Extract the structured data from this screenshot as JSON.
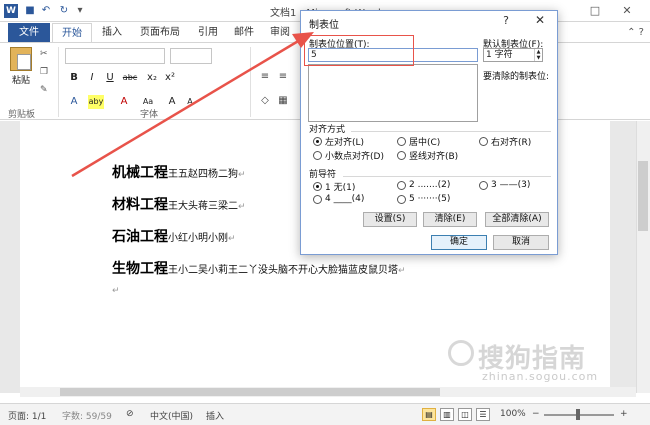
{
  "window": {
    "title": "文档1 - Microsoft Word",
    "app_logo": "W"
  },
  "ribbon_tabs": [
    {
      "label": "文件"
    },
    {
      "label": "开始"
    },
    {
      "label": "插入"
    },
    {
      "label": "页面布局"
    },
    {
      "label": "引用"
    },
    {
      "label": "邮件"
    },
    {
      "label": "审阅"
    }
  ],
  "ribbon": {
    "paste_label": "粘贴",
    "clipboard_group": "剪贴板",
    "font_group": "字体",
    "font_buttons": [
      "B",
      "I",
      "U",
      "abc",
      "x₂",
      "x²"
    ],
    "font_buttons2": [
      "A",
      "aby",
      "A",
      "Aa",
      "A",
      "A"
    ]
  },
  "document": {
    "lines": [
      {
        "head": "机械工程",
        "body": "王五赵四杨二狗"
      },
      {
        "head": "材料工程",
        "body": "王大头蒋三梁二"
      },
      {
        "head": "石油工程",
        "body": "小红小明小刚"
      },
      {
        "head": "生物工程",
        "body": "王小二吴小莉王二丫没头脑不开心大脸猫蓝皮鼠贝塔"
      }
    ],
    "para_mark": "↵"
  },
  "watermark": {
    "main": "搜狗指南",
    "sub": "zhinan.sogou.com"
  },
  "statusbar": {
    "page": "页面: 1/1",
    "words": "字数: 59/59",
    "language": "中文(中国)",
    "mode": "插入",
    "zoom": "100%"
  },
  "dialog": {
    "title": "制表位",
    "help": "?",
    "close": "✕",
    "tab_position_label": "制表位位置(T):",
    "tab_position_value": "5",
    "default_label": "默认制表位(F):",
    "default_value": "1 字符",
    "clear_label": "要清除的制表位:",
    "alignment_label": "对齐方式",
    "alignment_options": [
      {
        "label": "左对齐(L)",
        "checked": true
      },
      {
        "label": "居中(C)",
        "checked": false
      },
      {
        "label": "右对齐(R)",
        "checked": false
      },
      {
        "label": "小数点对齐(D)",
        "checked": false
      },
      {
        "label": "竖线对齐(B)",
        "checked": false
      }
    ],
    "leader_label": "前导符",
    "leader_options": [
      {
        "label": "1 无(1)",
        "checked": true
      },
      {
        "label": "2 .......(2)",
        "checked": false
      },
      {
        "label": "3 ——(3)",
        "checked": false
      },
      {
        "label": "4 ____(4)",
        "checked": false
      },
      {
        "label": "5 ·······(5)",
        "checked": false
      }
    ],
    "set_button": "设置(S)",
    "clear_button": "清除(E)",
    "clear_all_button": "全部清除(A)",
    "ok_button": "确定",
    "cancel_button": "取消"
  },
  "colors": {
    "word_blue": "#2b579a",
    "annotation_red": "#e8534a"
  }
}
